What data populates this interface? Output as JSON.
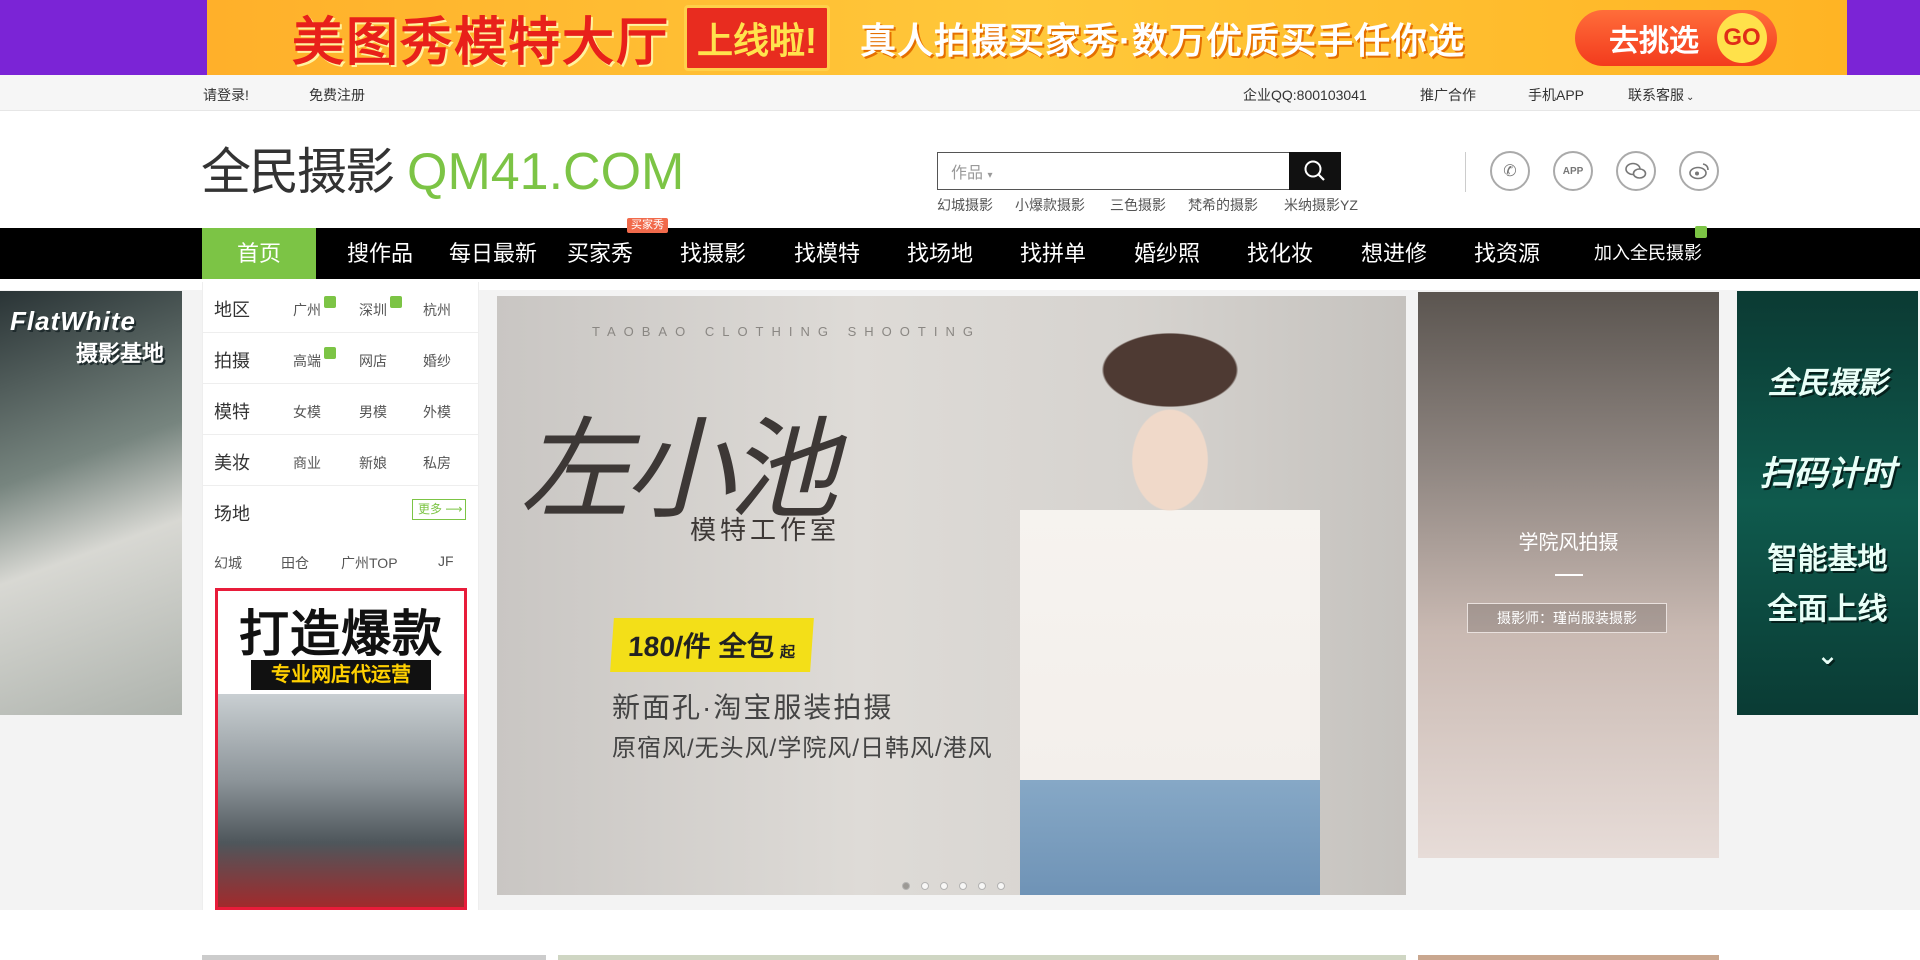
{
  "top_banner": {
    "title": "美图秀模特大厅",
    "badge": "上线啦!",
    "subtitle": "真人拍摄买家秀·数万优质买手任你选",
    "cta": "去挑选",
    "cta_go": "GO"
  },
  "utility_bar": {
    "login": "请登录!",
    "register": "免费注册",
    "enterprise_qq_label": "企业QQ:",
    "enterprise_qq": "800103041",
    "promotion": "推广合作",
    "mobile_app": "手机APP",
    "contact_service": "联系客服"
  },
  "header": {
    "logo_cn": "全民摄影",
    "logo_en": "QM41.COM",
    "search_category": "作品",
    "hot_links": [
      "幻城摄影",
      "小爆款摄影",
      "三色摄影",
      "梵希的摄影",
      "米纳摄影YZ"
    ],
    "icons": [
      "phone-icon",
      "app-icon",
      "wechat-icon",
      "weibo-icon"
    ]
  },
  "nav": {
    "items": [
      "首页",
      "搜作品",
      "每日最新",
      "买家秀",
      "找摄影",
      "找模特",
      "找场地",
      "找拼单",
      "婚纱照",
      "找化妆",
      "想进修",
      "找资源",
      "加入全民摄影"
    ],
    "active": "首页",
    "buyer_show_tag": "买家秀"
  },
  "categories": {
    "region": {
      "label": "地区",
      "items": [
        "广州",
        "深圳",
        "杭州"
      ]
    },
    "shoot": {
      "label": "拍摄",
      "items": [
        "高端",
        "网店",
        "婚纱"
      ]
    },
    "model": {
      "label": "模特",
      "items": [
        "女模",
        "男模",
        "外模"
      ]
    },
    "makeup": {
      "label": "美妆",
      "items": [
        "商业",
        "新娘",
        "私房"
      ]
    },
    "venue": {
      "label": "场地",
      "more": "更多",
      "items": [
        "幻城",
        "田仓",
        "广州TOP",
        "JF"
      ]
    }
  },
  "side_ad_left": {
    "line1": "FlatWhite",
    "line2": "摄影基地"
  },
  "side_ad_right": {
    "line1": "全民摄影",
    "line2": "扫码计时",
    "line3": "智能基地",
    "line4": "全面上线"
  },
  "left_ad": {
    "title": "打造爆款",
    "subtitle": "专业网店代运营"
  },
  "carousel": {
    "eyebrow": "TAOBAO CLOTHING SHOOTING",
    "brand": "左小池",
    "brand_sub": "模特工作室",
    "price": "180/件 全包",
    "price_suffix": "起",
    "line1": "新面孔·淘宝服装拍摄",
    "line2": "原宿风/无头风/学院风/日韩风/港风",
    "dots": 6,
    "active_dot": 0
  },
  "feature_card": {
    "title": "学院风拍摄",
    "caption": "摄影师：瑾尚服装摄影"
  },
  "colors": {
    "brand_green": "#7cc445",
    "nav_bg": "#000000",
    "banner_purple": "#7b24d6",
    "ad_red": "#e81c3a"
  }
}
